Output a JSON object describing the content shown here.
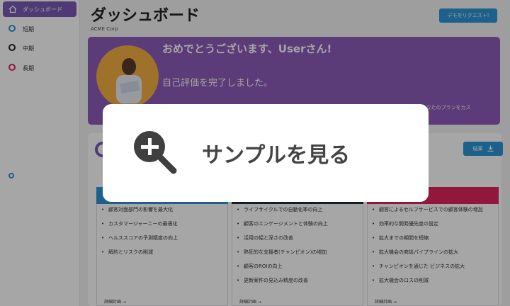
{
  "sidebar": {
    "items": [
      {
        "label": "ダッシュボード",
        "icon": "home-icon",
        "color": "#ffffff"
      },
      {
        "label": "短期",
        "icon": "circle-icon",
        "color": "#2b95d6"
      },
      {
        "label": "中期",
        "icon": "circle-icon",
        "color": "#222222"
      },
      {
        "label": "長期",
        "icon": "circle-icon",
        "color": "#e0245e"
      }
    ]
  },
  "header": {
    "title": "ダッシュボード",
    "company": "ACME Corp",
    "demo_button": "デモをリクエスト!"
  },
  "banner": {
    "greeting": "おめでとうございます、Userさん!",
    "message": "自己評価を完了しました。",
    "tail": "してあなたのプランをカス"
  },
  "card": {
    "result_button": "結果"
  },
  "columns": [
    {
      "header_color": "#2b95d6",
      "items": [
        "顧客対面部門の影響を最大化",
        "カスタマージャーニーの最適化",
        "ヘルススコアの予測精度の向上",
        "解約とリスクの削減"
      ],
      "detail": "詳細計画 →"
    },
    {
      "header_color": "#1f2a44",
      "items": [
        "ライフサイクルでの自動化率の向上",
        "顧客のエンゲージメントと体験の向上",
        "活用の幅と深さの改善",
        "熱狂的な支援者(チャンピオン)の増加",
        "顧客のROIの向上",
        "更新案件の見込み精度の改善"
      ],
      "detail": "詳細計画 →"
    },
    {
      "header_color": "#e0245e",
      "items": [
        "顧客によるセルフサービスでの顧客体験の増加",
        "効率的な開発優先度の設定",
        "拡大までの期間を短縮",
        "拡大機会の商談パイプラインの拡大",
        "チャンピオンを通じた ビジネスの拡大",
        "拡大機会のロスの削減"
      ],
      "detail": "詳細計画 →"
    }
  ],
  "popup": {
    "label": "サンプルを見る",
    "icon": "zoom-in-icon"
  },
  "colors": {
    "accent_purple": "#8d5bb8",
    "button_blue": "#2b95d6",
    "banner_orange": "#f4b042"
  }
}
